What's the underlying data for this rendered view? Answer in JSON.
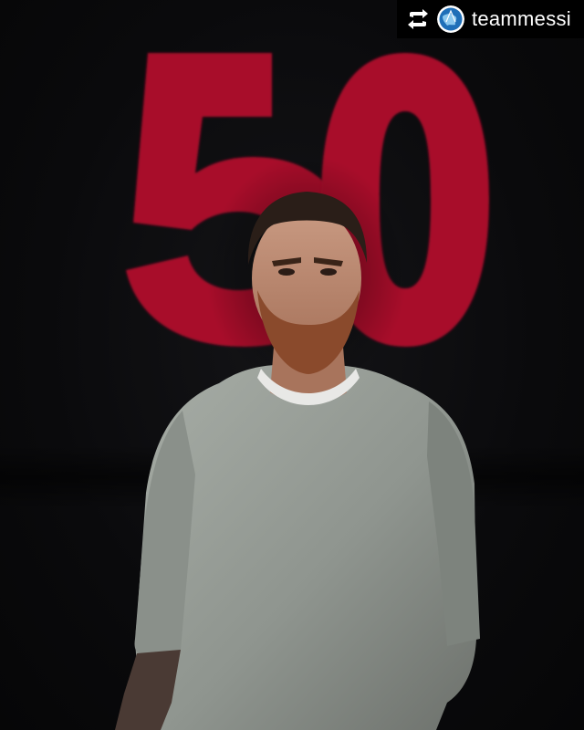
{
  "overlay": {
    "handle": "teammessi",
    "repost_icon": "repost-icon",
    "avatar_icon": "globe-avatar-icon"
  },
  "graphic": {
    "number_text": "50",
    "number_color": "#a8082c",
    "background_color": "#0b0b0d"
  }
}
